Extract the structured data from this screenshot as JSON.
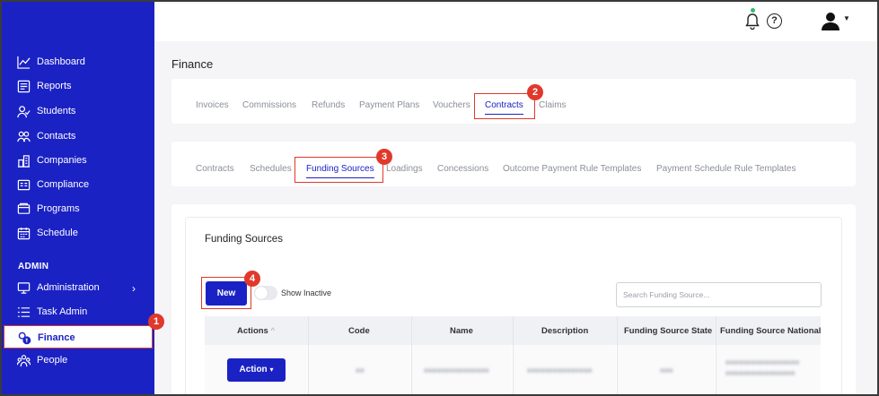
{
  "sidebar": {
    "items": [
      {
        "label": "Dashboard",
        "icon": "chart-line-icon"
      },
      {
        "label": "Reports",
        "icon": "report-icon"
      },
      {
        "label": "Students",
        "icon": "students-icon"
      },
      {
        "label": "Contacts",
        "icon": "contacts-icon"
      },
      {
        "label": "Companies",
        "icon": "companies-icon"
      },
      {
        "label": "Compliance",
        "icon": "compliance-icon"
      },
      {
        "label": "Programs",
        "icon": "programs-icon"
      },
      {
        "label": "Schedule",
        "icon": "calendar-icon"
      }
    ],
    "admin_heading": "ADMIN",
    "admin_items": [
      {
        "label": "Administration",
        "icon": "monitor-icon"
      },
      {
        "label": "Task Admin",
        "icon": "list-icon"
      },
      {
        "label": "Finance",
        "icon": "finance-icon",
        "active": true
      },
      {
        "label": "People",
        "icon": "people-icon"
      }
    ],
    "chevron": "›"
  },
  "header": {
    "help": "?"
  },
  "page": {
    "title": "Finance"
  },
  "primary_tabs": [
    "Invoices",
    "Commissions",
    "Refunds",
    "Payment Plans",
    "Vouchers",
    "Contracts",
    "Claims"
  ],
  "secondary_tabs": [
    "Contracts",
    "Schedules",
    "Funding Sources",
    "Loadings",
    "Concessions",
    "Outcome Payment Rule Templates",
    "Payment Schedule Rule Templates"
  ],
  "section": {
    "title": "Funding Sources",
    "new_label": "New",
    "show_inactive_label": "Show Inactive",
    "search_placeholder": "Search Funding Source..."
  },
  "table": {
    "columns": [
      "Actions",
      "Code",
      "Name",
      "Description",
      "Funding Source State",
      "Funding Source National"
    ],
    "sort_indicator": "^",
    "action_label": "Action",
    "action_caret": "▾"
  },
  "callouts": [
    "1",
    "2",
    "3",
    "4"
  ],
  "colors": {
    "brand": "#1b22c4",
    "callout": "#e0392b",
    "online": "#2ebf6b"
  }
}
